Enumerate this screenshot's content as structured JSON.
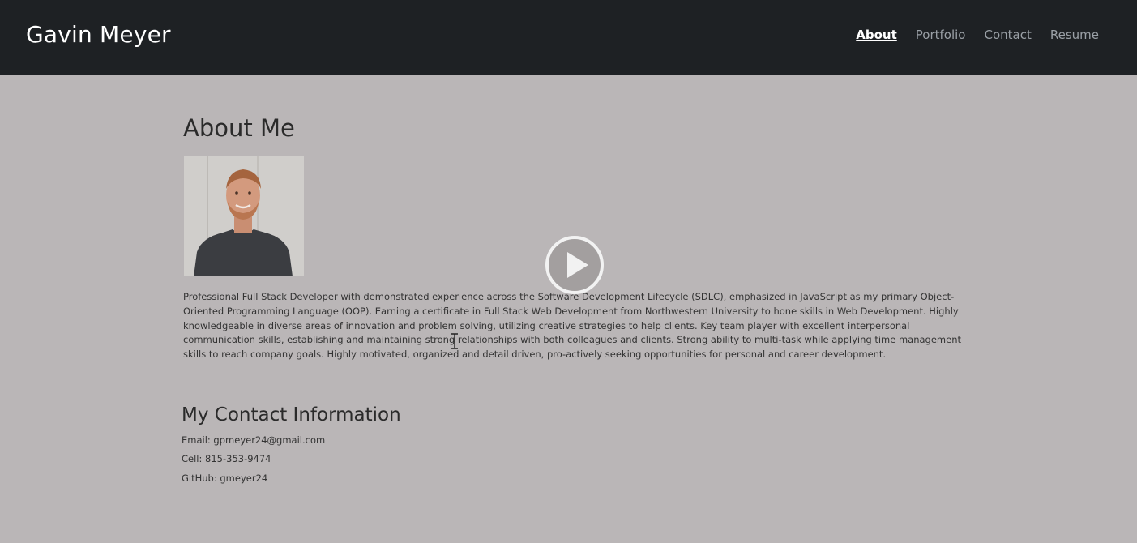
{
  "header": {
    "brand": "Gavin Meyer",
    "nav": [
      {
        "label": "About",
        "active": true
      },
      {
        "label": "Portfolio",
        "active": false
      },
      {
        "label": "Contact",
        "active": false
      },
      {
        "label": "Resume",
        "active": false
      }
    ]
  },
  "about": {
    "title": "About Me",
    "bio": "Professional Full Stack Developer with demonstrated experience across the Software Development Lifecycle (SDLC), emphasized in JavaScript as my primary Object-Oriented Programming Language (OOP). Earning a certificate in Full Stack Web Development from Northwestern University to hone skills in Web Development. Highly knowledgeable in diverse areas of innovation and problem solving, utilizing creative strategies to help clients. Key team player with excellent interpersonal communication skills, establishing and maintaining strong relationships with both colleagues and clients. Strong ability to multi-task while applying time management skills to reach company goals. Highly motivated, organized and detail driven, pro-actively seeking opportunities for personal and career development."
  },
  "contact": {
    "title": "My Contact Information",
    "email": "Email: gpmeyer24@gmail.com",
    "cell": "Cell: 815-353-9474",
    "github": "GitHub: gmeyer24"
  },
  "icons": {
    "play": "play-icon",
    "cursor": "text-cursor-icon"
  },
  "colors": {
    "navbar": "#1e2124",
    "page_background": "#bab6b7",
    "nav_inactive": "#9aa0a6",
    "nav_active": "#ffffff"
  }
}
